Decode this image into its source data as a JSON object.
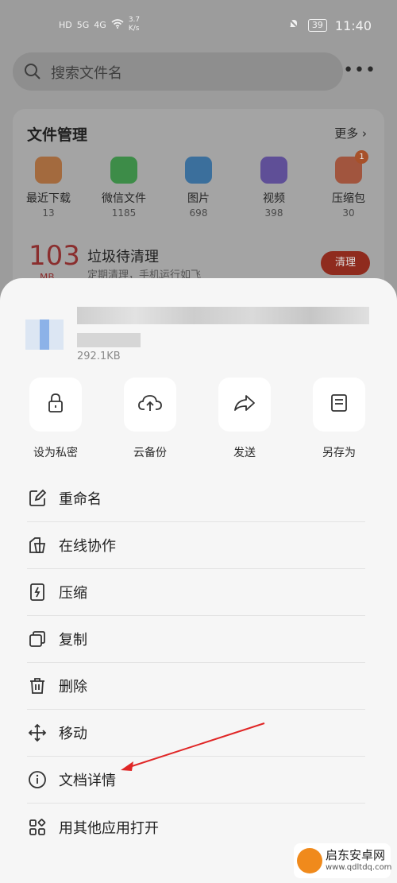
{
  "status_bar": {
    "left": [
      "HD",
      "5G",
      "4G",
      "3.7",
      "K/s"
    ],
    "battery": "39",
    "time": "11:40"
  },
  "search": {
    "placeholder": "搜索文件名"
  },
  "file_management": {
    "title": "文件管理",
    "more": "更多",
    "categories": [
      {
        "label": "最近下载",
        "count": "13",
        "color": "#a36a3e",
        "icon": "download-icon"
      },
      {
        "label": "微信文件",
        "count": "1185",
        "color": "#3d8c48",
        "icon": "wechat-icon"
      },
      {
        "label": "图片",
        "count": "698",
        "color": "#3b6f9c",
        "icon": "image-icon"
      },
      {
        "label": "视频",
        "count": "398",
        "color": "#5f4f97",
        "icon": "video-icon"
      },
      {
        "label": "压缩包",
        "count": "30",
        "color": "#a1553e",
        "icon": "archive-icon",
        "badge": "1"
      }
    ],
    "cleanup": {
      "number": "103",
      "unit": "MB",
      "title": "垃圾待清理",
      "subtitle": "定期清理，手机运行如飞",
      "button": "清理"
    }
  },
  "sheet": {
    "file_size": "292.1KB",
    "actions": [
      {
        "label": "设为私密",
        "icon": "lock-icon"
      },
      {
        "label": "云备份",
        "icon": "cloud-upload-icon"
      },
      {
        "label": "发送",
        "icon": "share-arrow-icon"
      },
      {
        "label": "另存为",
        "icon": "save-icon"
      }
    ],
    "menu": [
      {
        "label": "重命名",
        "icon": "edit-icon"
      },
      {
        "label": "在线协作",
        "icon": "collaborate-icon"
      },
      {
        "label": "压缩",
        "icon": "compress-icon"
      },
      {
        "label": "复制",
        "icon": "copy-icon"
      },
      {
        "label": "删除",
        "icon": "trash-icon"
      },
      {
        "label": "移动",
        "icon": "move-icon"
      },
      {
        "label": "文档详情",
        "icon": "info-icon"
      },
      {
        "label": "用其他应用打开",
        "icon": "apps-icon"
      }
    ]
  },
  "annotation": {
    "color": "#e02626"
  },
  "watermark": {
    "title": "启东安卓网",
    "url": "www.qdltdq.com"
  }
}
